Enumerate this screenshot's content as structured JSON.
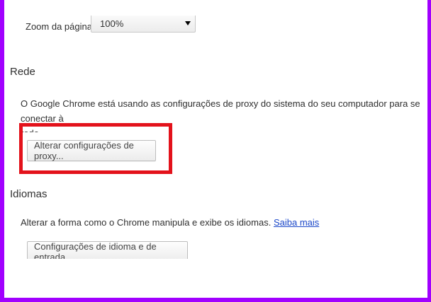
{
  "zoom": {
    "label": "Zoom da página:",
    "value": "100%"
  },
  "rede": {
    "heading": "Rede",
    "description_line1": "O Google Chrome está usando as configurações de proxy do sistema do seu computador para se conectar à",
    "description_line2": "rede.",
    "proxy_button": "Alterar configurações de proxy..."
  },
  "idiomas": {
    "heading": "Idiomas",
    "description": "Alterar a forma como o Chrome manipula e exibe os idiomas.",
    "link": "Saiba mais",
    "button": "Configurações de idioma e de entrada..."
  },
  "colors": {
    "highlight": "#e3121b",
    "frame": "#a100ff",
    "link": "#1a47c9"
  }
}
